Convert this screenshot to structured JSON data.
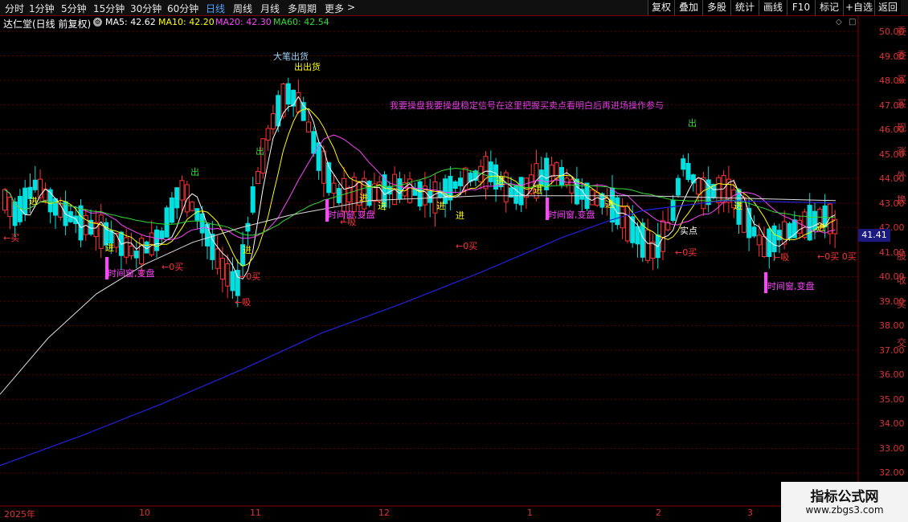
{
  "toolbar": {
    "periods": [
      "分时",
      "1分钟",
      "5分钟",
      "15分钟",
      "30分钟",
      "60分钟",
      "日线",
      "周线",
      "月线",
      "多周期",
      "更多"
    ],
    "active_period": "日线",
    "more_arrow": ">",
    "right_buttons": [
      "复权",
      "叠加",
      "多股",
      "统计",
      "画线",
      "F10",
      "标记",
      "+自选",
      "返回"
    ]
  },
  "header": {
    "title": "达仁堂(日线 前复权)",
    "ma": [
      {
        "label": "MA5: 42.62",
        "color": "#ffffff"
      },
      {
        "label": "MA10: 42.20",
        "color": "#ffff00"
      },
      {
        "label": "MA20: 42.30",
        "color": "#ff44ff"
      },
      {
        "label": "MA60: 42.54",
        "color": "#33dd33"
      }
    ]
  },
  "chart": {
    "price_axis": [
      "50.00",
      "49.00",
      "48.00",
      "47.00",
      "46.00",
      "45.00",
      "44.00",
      "43.00",
      "42.00",
      "41.00",
      "40.00",
      "39.00",
      "38.00",
      "37.00",
      "36.00",
      "35.00",
      "34.00",
      "33.00",
      "32.00"
    ],
    "time_axis": [
      "2025年",
      "10",
      "11",
      "12",
      "1",
      "2",
      "3"
    ],
    "last_price": "41.41",
    "marquee_text": "我要操盘我要操盘稳定信号在这里把握买卖点看明白后再进场操作参与"
  },
  "signals": [
    {
      "text": "大笔出货",
      "color": "#9ad4ff"
    },
    {
      "text": "出出货",
      "color": "#ffff00"
    },
    {
      "text": "出",
      "color": "#33dd33"
    },
    {
      "text": "出",
      "color": "#33dd33"
    },
    {
      "text": "出",
      "color": "#33dd33"
    },
    {
      "text": "进",
      "color": "#ffff00"
    },
    {
      "text": "进",
      "color": "#ffff00"
    },
    {
      "text": "进",
      "color": "#ffff00"
    },
    {
      "text": "进",
      "color": "#ffff00"
    },
    {
      "text": "进",
      "color": "#ffff00"
    },
    {
      "text": "进",
      "color": "#ffff00"
    },
    {
      "text": "进",
      "color": "#ffff00"
    },
    {
      "text": "进",
      "color": "#ffff00"
    },
    {
      "text": "进",
      "color": "#ffff00"
    },
    {
      "text": "进",
      "color": "#ffff00"
    },
    {
      "text": "进",
      "color": "#ffff00"
    },
    {
      "text": "进",
      "color": "#ffff00"
    },
    {
      "text": "←买",
      "color": "#ff3333"
    },
    {
      "text": "←0买",
      "color": "#ff3333"
    },
    {
      "text": "←0买",
      "color": "#ff3333"
    },
    {
      "text": "←0买",
      "color": "#ff3333"
    },
    {
      "text": "←0买",
      "color": "#ff3333"
    },
    {
      "text": "←0买 0买",
      "color": "#ff3333"
    },
    {
      "text": "←吸",
      "color": "#ff3333"
    },
    {
      "text": "←吸",
      "color": "#ff3333"
    },
    {
      "text": "←吸",
      "color": "#ff3333"
    },
    {
      "text": "实点",
      "color": "#ffffff"
    },
    {
      "text": "时间窗,变盘",
      "color": "#ff44ff"
    },
    {
      "text": "时间窗,变盘",
      "color": "#ff44ff"
    },
    {
      "text": "时间窗,变盘",
      "color": "#ff44ff"
    },
    {
      "text": "时间窗,变盘",
      "color": "#ff44ff"
    }
  ],
  "side_panel": [
    "委",
    "委",
    "买",
    "买",
    "现",
    "涨",
    "外",
    "换",
    "股",
    "收",
    "买",
    "交"
  ],
  "watermark": {
    "title": "指标公式网",
    "url": "www.zbgs3.com"
  },
  "colors": {
    "up": "#ff3333",
    "down": "#00e0e0",
    "ma5": "#ffffff",
    "ma10": "#ffff00",
    "ma20": "#ff44ff",
    "ma60": "#33dd33",
    "ma250": "#2222dd",
    "ma120": "#dddddd"
  }
}
